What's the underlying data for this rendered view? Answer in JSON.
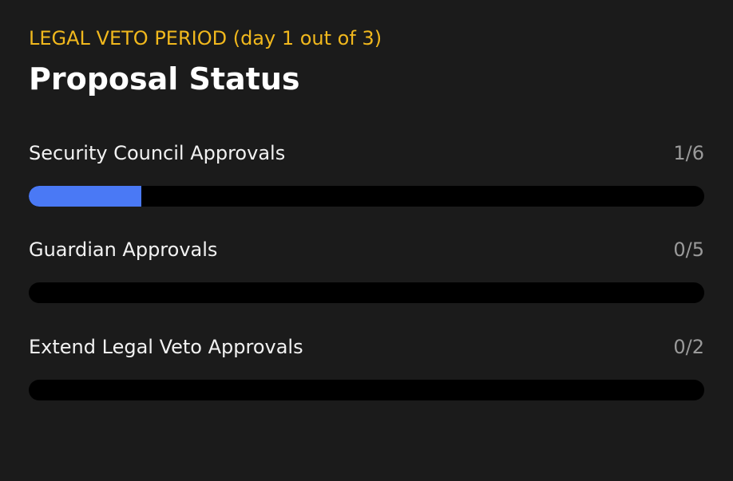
{
  "header": {
    "phase_label": "LEGAL VETO PERIOD (day 1 out of 3)",
    "title": "Proposal Status"
  },
  "colors": {
    "phase": "#f1b81d",
    "progress_fill": "#4a79f5",
    "track": "#000000"
  },
  "approvals": [
    {
      "label": "Security Council Approvals",
      "count_text": "1/6",
      "current": 1,
      "required": 6
    },
    {
      "label": "Guardian Approvals",
      "count_text": "0/5",
      "current": 0,
      "required": 5
    },
    {
      "label": "Extend Legal Veto Approvals",
      "count_text": "0/2",
      "current": 0,
      "required": 2
    }
  ]
}
